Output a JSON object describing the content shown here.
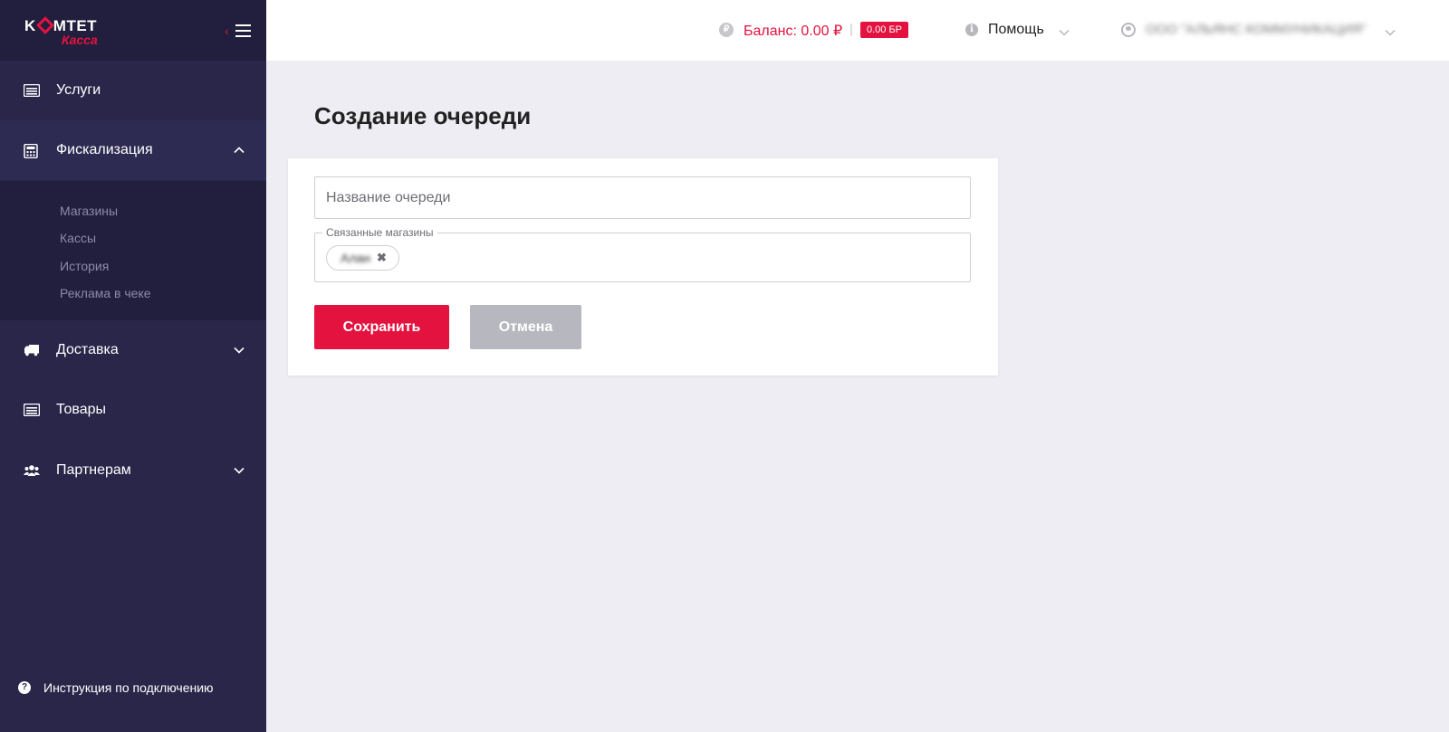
{
  "brand": {
    "logo_top": "KOMTET",
    "logo_bottom": "Касса"
  },
  "sidebar": {
    "items": [
      {
        "label": "Услуги",
        "icon": "list-icon",
        "expanded": false
      },
      {
        "label": "Фискализация",
        "icon": "calculator-icon",
        "expanded": true,
        "children": [
          "Магазины",
          "Кассы",
          "История",
          "Реклама в чеке"
        ]
      },
      {
        "label": "Доставка",
        "icon": "truck-icon",
        "expanded": false
      },
      {
        "label": "Товары",
        "icon": "list-icon",
        "expanded": false
      },
      {
        "label": "Партнерам",
        "icon": "users-icon",
        "expanded": false
      }
    ],
    "help_link": "Инструкция по подключению"
  },
  "header": {
    "balance": "Баланс: 0.00 ₽",
    "balance_icon": "₽",
    "separator": "|",
    "bp_badge": "0.00 БР",
    "help_menu": "Помощь",
    "user_name": "ООО \"АЛЬЯНС КОММУНИКАЦИЯ\""
  },
  "main": {
    "page_title": "Создание очереди",
    "queue_name": {
      "value": "",
      "placeholder": "Название очереди"
    },
    "linked_shops": {
      "label": "Связанные магазины",
      "chips": [
        "Алан"
      ]
    },
    "save_label": "Сохранить",
    "cancel_label": "Отмена"
  },
  "colors": {
    "accent": "#e4123f",
    "sidebar_bg": "#29264a",
    "sidebar_dark": "#211f3d",
    "page_bg": "#eeedf3",
    "cancel_bg": "#b7b7bf"
  }
}
